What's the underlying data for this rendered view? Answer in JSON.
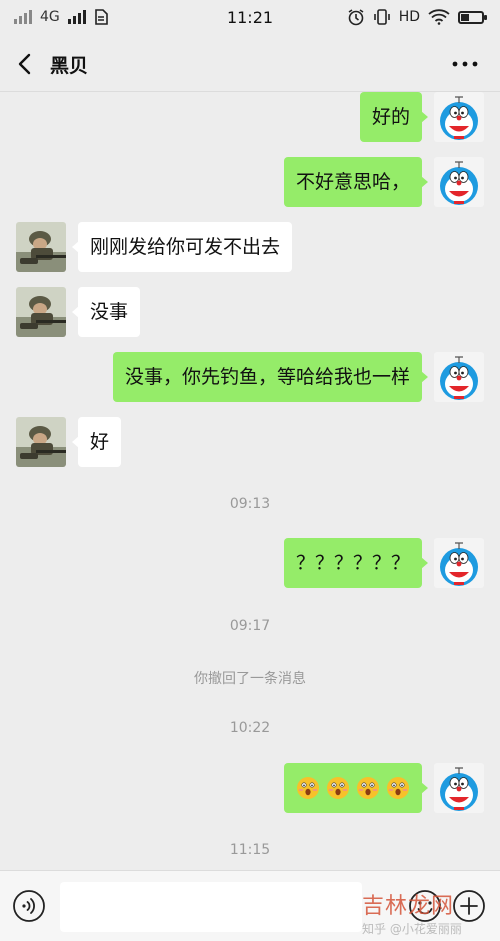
{
  "status_bar": {
    "network": "4G",
    "time": "11:21",
    "hd": "HD",
    "battery_level": 0.4
  },
  "header": {
    "title": "黑贝",
    "more": "•••"
  },
  "messages": [
    {
      "side": "right",
      "text": "好的"
    },
    {
      "side": "right",
      "text": "不好意思哈，"
    },
    {
      "side": "left",
      "text": "刚刚发给你可发不出去"
    },
    {
      "side": "left",
      "text": "没事"
    },
    {
      "side": "right",
      "text": "没事，你先钓鱼，等哈给我也一样"
    },
    {
      "side": "left",
      "text": "好"
    },
    {
      "side": "right",
      "text": "？？？？？？"
    },
    {
      "side": "right",
      "emoji_count": 4,
      "emoji": "face-icon"
    }
  ],
  "system": {
    "time_1": "09:13",
    "time_2": "09:17",
    "recall": "你撤回了一条消息",
    "time_3": "10:22",
    "time_4": "11:15"
  },
  "input_bar": {
    "placeholder": "",
    "voice_icon": "voice-icon",
    "emoji_icon": "smile-icon",
    "plus_icon": "plus-icon"
  },
  "watermark": {
    "main": "吉林龙网",
    "sub": "知乎 @小花爱丽丽"
  },
  "colors": {
    "background": "#ededed",
    "sent_bubble": "#95ec69",
    "received_bubble": "#ffffff",
    "system_text": "#999999"
  }
}
